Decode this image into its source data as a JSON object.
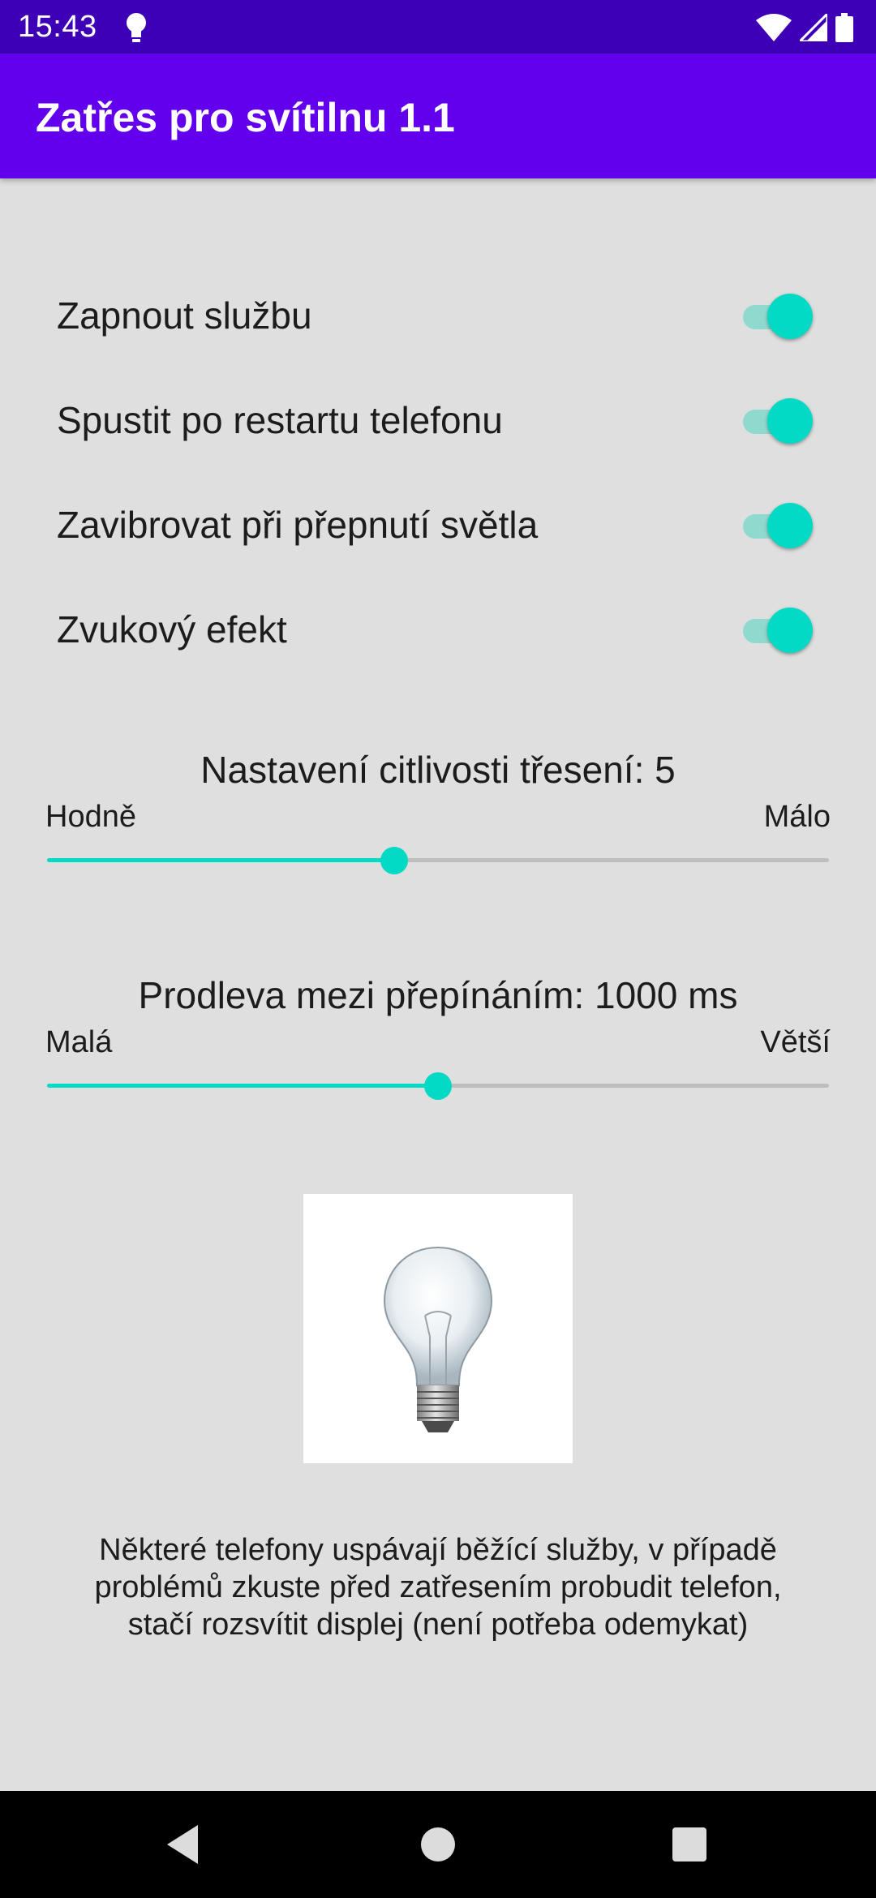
{
  "status_bar": {
    "time": "15:43",
    "icons": [
      "lightbulb-icon",
      "wifi-icon",
      "signal-icon",
      "battery-icon"
    ]
  },
  "app_bar": {
    "title": "Zatřes pro svítilnu 1.1",
    "color": "#6200ee"
  },
  "settings": [
    {
      "label": "Zapnout službu",
      "enabled": true
    },
    {
      "label": "Spustit po restartu telefonu",
      "enabled": true
    },
    {
      "label": "Zavibrovat při přepnutí světla",
      "enabled": true
    },
    {
      "label": "Zvukový efekt",
      "enabled": true
    }
  ],
  "sensitivity": {
    "title": "Nastavení citlivosti třesení: 5",
    "min_label": "Hodně",
    "max_label": "Málo",
    "value_fraction": 0.444
  },
  "delay": {
    "title": "Prodleva mezi přepínáním: 1000 ms",
    "min_label": "Malá",
    "max_label": "Větší",
    "value_fraction": 0.5
  },
  "image": {
    "icon": "lightbulb-image"
  },
  "note": {
    "line1": "Některé telefony uspávají běžící služby, v případě",
    "line2": "problémů zkuste před zatřesením probudit telefon,",
    "line3": "stačí rozsvítit displej (není potřeba odemykat)"
  },
  "navigation": [
    "back-icon",
    "home-icon",
    "recents-icon"
  ],
  "colors": {
    "accent": "#03dac5",
    "status_bar": "#3d00b6",
    "background": "#dfdfdf"
  }
}
